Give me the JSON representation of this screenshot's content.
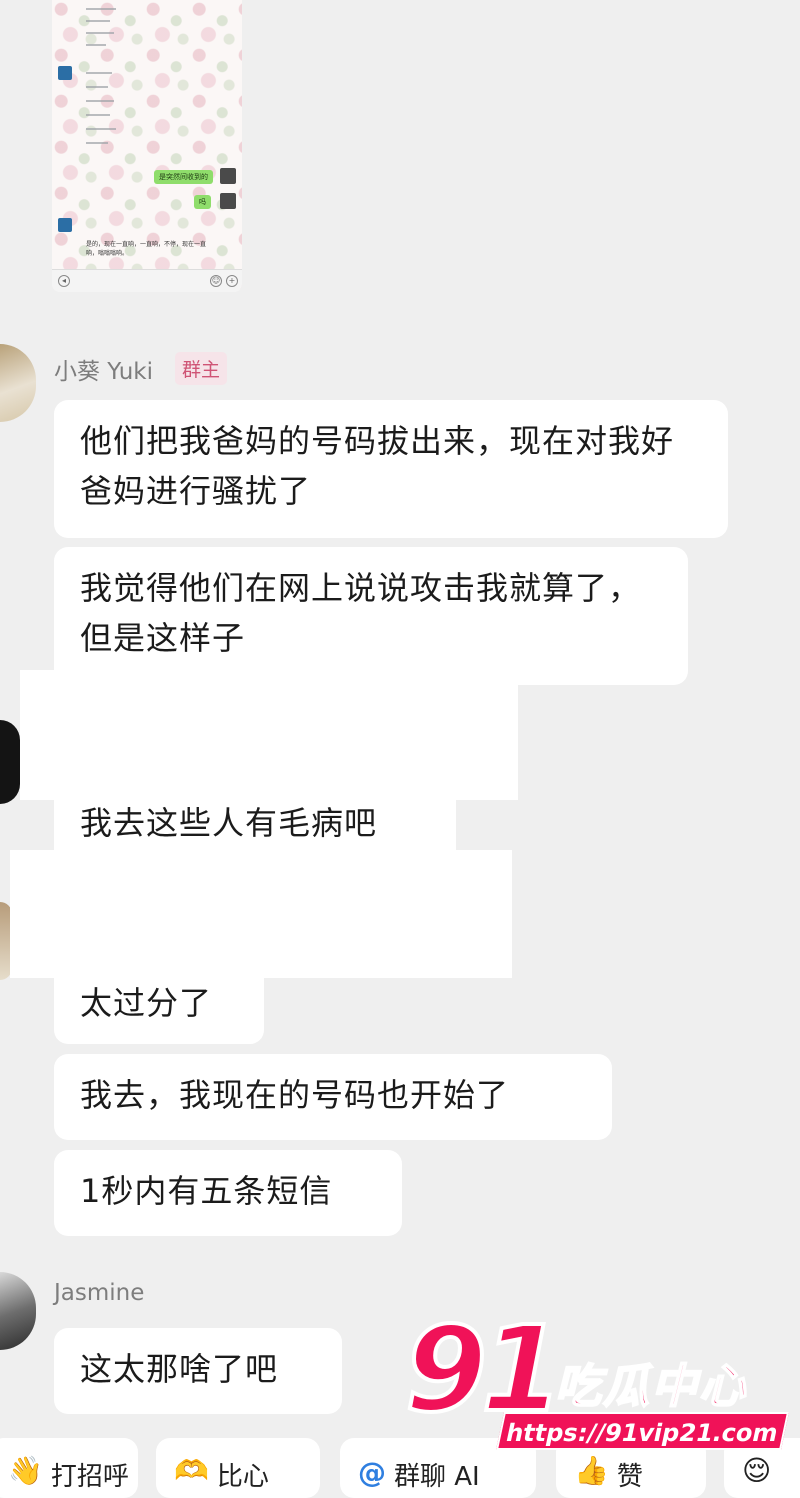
{
  "colors": {
    "background": "#efefef",
    "bubble": "#ffffff",
    "owner_badge": "#cf5475",
    "watermark": "#f01258"
  },
  "screenshot_preview": {
    "green_bubble_1": "是突然间收到的",
    "green_bubble_2": "吗",
    "reply_text": "是的，现在一直响，一直响，不停，现在一直响，嗡嗡嗡响。",
    "input_icons": [
      "voice-icon",
      "emoji-icon",
      "plus-icon"
    ]
  },
  "messages": {
    "yuki": {
      "name": "小葵 Yuki",
      "badge": "群主",
      "bubbles": [
        "他们把我爸妈的号码拔出来，现在对我好爸妈进行骚扰了",
        "我觉得他们在网上说说攻击我就算了，但是这样子"
      ]
    },
    "hidden_1": {
      "text": "我去这些人有毛病吧"
    },
    "hidden_2": {
      "bubbles": [
        "太过分了",
        "我去，我现在的号码也开始了",
        "1秒内有五条短信"
      ]
    },
    "jasmine": {
      "name": "Jasmine",
      "bubbles": [
        "这太那啥了吧"
      ]
    }
  },
  "quick_actions": [
    {
      "label": "打招呼",
      "icon": "wave-icon"
    },
    {
      "label": "比心",
      "icon": "heart-hands-icon"
    },
    {
      "label": "群聊 AI",
      "icon": "at-icon"
    },
    {
      "label": "赞",
      "icon": "thumbs-up-icon"
    },
    {
      "label": "",
      "icon": "emoji-icon"
    }
  ],
  "watermark": {
    "number": "91",
    "title": "吃瓜中心",
    "url": "https://91vip21.com"
  }
}
